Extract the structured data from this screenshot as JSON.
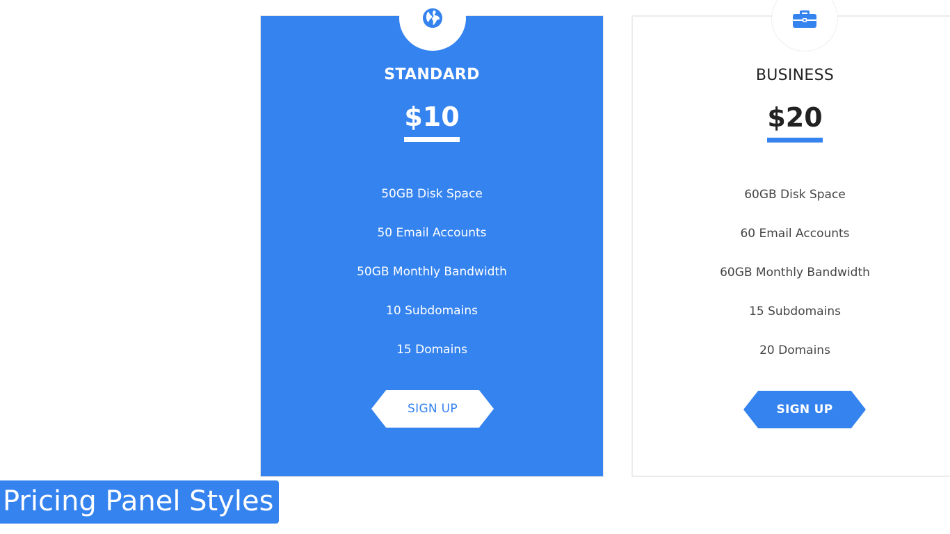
{
  "plans": [
    {
      "icon": "globe-icon",
      "title": "STANDARD",
      "price": "$10",
      "features": [
        "50GB Disk Space",
        "50 Email Accounts",
        "50GB Monthly Bandwidth",
        "10 Subdomains",
        "15 Domains"
      ],
      "button_label": "SIGN UP"
    },
    {
      "icon": "briefcase-icon",
      "title": "BUSINESS",
      "price": "$20",
      "features": [
        "60GB Disk Space",
        "60 Email Accounts",
        "60GB Monthly Bandwidth",
        "15 Subdomains",
        "20 Domains"
      ],
      "button_label": "SIGN UP"
    }
  ],
  "caption": "Pricing Panel Styles",
  "colors": {
    "accent": "#3583ef",
    "card_bg_light": "#ffffff"
  }
}
